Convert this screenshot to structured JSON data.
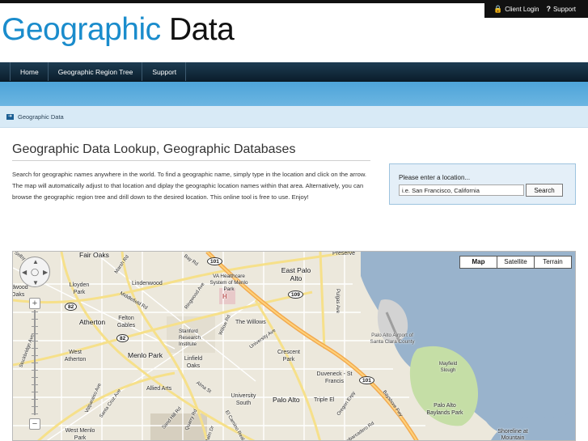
{
  "header": {
    "top_links": [
      {
        "icon": "lock-icon",
        "glyph": "ǿ",
        "label": "Client Login"
      },
      {
        "icon": "question-icon",
        "glyph": "?",
        "label": "Support"
      }
    ],
    "logo": {
      "part1": "Geographic",
      "part2": "Data"
    }
  },
  "nav": {
    "items": [
      "Home",
      "Geographic Region Tree",
      "Support"
    ]
  },
  "breadcrumb": {
    "label": "Geographic Data"
  },
  "main": {
    "title": "Geographic Data Lookup, Geographic Databases",
    "intro": "Search for geographic names anywhere in the world. To find a geographic name, simply type in the location and click on the arrow. The map will automatically adjust to that location and diplay the geographic location names within that area. Alternatively, you can browse the geographic region tree and drill down to the desired location. This online tool is free to use. Enjoy!"
  },
  "search": {
    "label": "Please enter a location...",
    "placeholder": "i.e. San Francisco, California",
    "button": "Search"
  },
  "map": {
    "types": [
      "Map",
      "Satellite",
      "Terrain"
    ],
    "selected_type": "Map",
    "zoom_in": "+",
    "zoom_out": "−",
    "places": [
      "Fair Oaks",
      "Preserve",
      "East Palo Alto",
      "Lloyden Park",
      "Lindenwood",
      "VA Healthcare System of Menlo Park",
      "Atherton",
      "Felton Gables",
      "The Willows",
      "Stanford Research Institute",
      "West Atherton",
      "Menlo Park",
      "Linfield Oaks",
      "Crescent Park",
      "Palo Alto Airport of Santa Clara County",
      "Mayfield Slough",
      "Duveneck - St Francis",
      "Allied Arts",
      "University South",
      "Palo Alto",
      "Triple El",
      "Palo Alto Baylands Park",
      "Shoreline at Mountain",
      "West Menlo Park",
      "dwood Oaks"
    ],
    "roads": [
      "Bay Rd",
      "Marsh Rd",
      "Middlefield Rd",
      "Ringwood Ave",
      "Willow Rd",
      "University Ave",
      "Pulgas Ave",
      "Alma St",
      "Sand Hill Rd",
      "Quarry Rd",
      "El Camino Real",
      "Oregon Expy",
      "Bayshore Fwy",
      "Santa Cruz Ave",
      "Valparaiso Ave",
      "Stockbridge Ave",
      "Selby Ln",
      "Palm Dr",
      "Embarcadero Rd"
    ],
    "shields": [
      "101",
      "109",
      "82",
      "82",
      "101"
    ],
    "markers": [
      "H"
    ]
  }
}
